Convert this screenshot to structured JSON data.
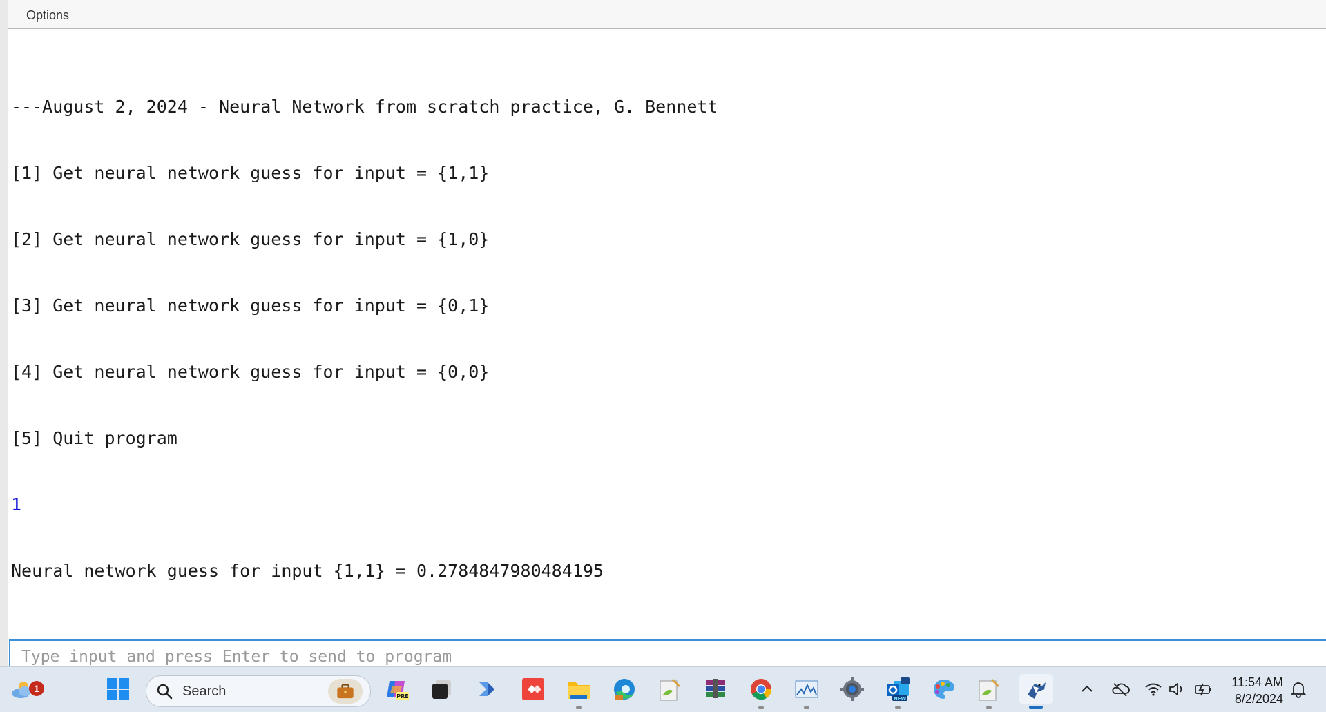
{
  "menu": {
    "options_label": "Options"
  },
  "console": {
    "lines": [
      "---August 2, 2024 - Neural Network from scratch practice, G. Bennett",
      "[1] Get neural network guess for input = {1,1}",
      "[2] Get neural network guess for input = {1,0}",
      "[3] Get neural network guess for input = {0,1}",
      "[4] Get neural network guess for input = {0,0}",
      "[5] Quit program",
      "1",
      "Neural network guess for input {1,1} = 0.2784847980484195"
    ],
    "echo_color": "#1515d8"
  },
  "input": {
    "placeholder": "Type input and press Enter to send to program",
    "value": ""
  },
  "taskbar": {
    "weather_badge": "1",
    "search_label": "Search",
    "copilot_badge": "PRE",
    "outlook_badge": "NEW",
    "icons": [
      "weather-icon",
      "windows-start-icon",
      "search-icon",
      "briefcase-icon",
      "copilot-icon",
      "task-view-icon",
      "power-automate-icon",
      "anydesk-icon",
      "file-explorer-icon",
      "edge-icon",
      "notepad-plus-icon",
      "winrar-icon",
      "chrome-icon",
      "performance-monitor-icon",
      "settings-icon",
      "outlook-icon",
      "paint-icon",
      "notepad-plus-icon-2",
      "bluej-icon"
    ],
    "tray": {
      "time": "11:54 AM",
      "date": "8/2/2024"
    }
  }
}
